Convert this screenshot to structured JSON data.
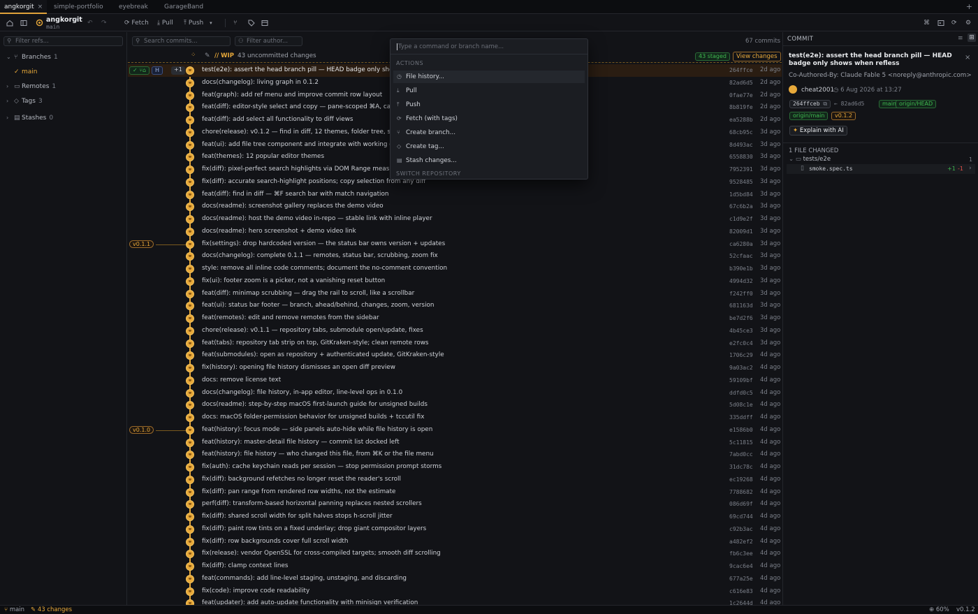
{
  "tabs": [
    {
      "label": "angkorgit",
      "active": true
    },
    {
      "label": "simple-portfolio"
    },
    {
      "label": "eyebreak"
    },
    {
      "label": "GarageBand"
    }
  ],
  "toolbar": {
    "repo_name": "angkorgit",
    "repo_branch": "main",
    "fetch": "Fetch",
    "pull": "Pull",
    "push": "Push"
  },
  "sidebar": {
    "filter_placeholder": "Filter refs...",
    "branches": {
      "label": "Branches",
      "count": "1"
    },
    "branch_main": "main",
    "remotes": {
      "label": "Remotes",
      "count": "1"
    },
    "tags": {
      "label": "Tags",
      "count": "3"
    },
    "stashes": {
      "label": "Stashes",
      "count": "0"
    }
  },
  "graph": {
    "search_placeholder": "Search commits...",
    "author_placeholder": "Filter author...",
    "commit_count": "67 commits",
    "wip_label": "WIP",
    "wip_text": "43 uncommitted changes",
    "staged": "43 staged",
    "view_changes": "View changes",
    "head_badge": "H",
    "plus_badge": "+1"
  },
  "commits": [
    {
      "msg": "test(e2e): assert the head branch pill — HEAD badge only shows wh",
      "sha": "264ffce",
      "ago": "2d ago"
    },
    {
      "msg": "docs(changelog): living graph in 0.1.2",
      "sha": "82ad6d5",
      "ago": "2d ago"
    },
    {
      "msg": "feat(graph): add ref menu and improve commit row layout",
      "sha": "0fae77e",
      "ago": "2d ago"
    },
    {
      "msg": "feat(diff): editor-style select and copy — pane-scoped ⌘A, caret, I-b",
      "sha": "8b819fe",
      "ago": "2d ago"
    },
    {
      "msg": "feat(diff): add select all functionality to diff views",
      "sha": "ea5288b",
      "ago": "2d ago"
    },
    {
      "msg": "chore(release): v0.1.2 — find in diff, 12 themes, folder tree, stash pre",
      "sha": "68cb95c",
      "ago": "3d ago"
    },
    {
      "msg": "feat(ui): add file tree component and integrate with working copy pa",
      "sha": "8d493ac",
      "ago": "3d ago"
    },
    {
      "msg": "feat(themes): 12 popular editor themes",
      "sha": "6558830",
      "ago": "3d ago"
    },
    {
      "msg": "fix(diff): pixel-perfect search highlights via DOM Range measuremen",
      "sha": "7952391",
      "ago": "3d ago"
    },
    {
      "msg": "fix(diff): accurate search-highlight positions; copy selection from any diff",
      "sha": "9528485",
      "ago": "3d ago"
    },
    {
      "msg": "feat(diff): find in diff — ⌘F search bar with match navigation",
      "sha": "1d5bd84",
      "ago": "3d ago"
    },
    {
      "msg": "docs(readme): screenshot gallery replaces the demo video",
      "sha": "67c6b2a",
      "ago": "3d ago"
    },
    {
      "msg": "docs(readme): host the demo video in-repo — stable link with inline player",
      "sha": "c1d9e2f",
      "ago": "3d ago"
    },
    {
      "msg": "docs(readme): hero screenshot + demo video link",
      "sha": "82009d1",
      "ago": "3d ago"
    },
    {
      "msg": "fix(settings): drop hardcoded version — the status bar owns version + updates",
      "sha": "ca6280a",
      "ago": "3d ago",
      "tag": "v0.1.1"
    },
    {
      "msg": "docs(changelog): complete 0.1.1 — remotes, status bar, scrubbing, zoom fix",
      "sha": "52cfaac",
      "ago": "3d ago"
    },
    {
      "msg": "style: remove all inline code comments; document the no-comment convention",
      "sha": "b390e1b",
      "ago": "3d ago"
    },
    {
      "msg": "fix(ui): footer zoom is a picker, not a vanishing reset button",
      "sha": "4994d32",
      "ago": "3d ago"
    },
    {
      "msg": "feat(diff): minimap scrubbing — drag the rail to scroll, like a scrollbar",
      "sha": "f242ff0",
      "ago": "3d ago"
    },
    {
      "msg": "feat(ui): status bar footer — branch, ahead/behind, changes, zoom, version",
      "sha": "681163d",
      "ago": "3d ago"
    },
    {
      "msg": "feat(remotes): edit and remove remotes from the sidebar",
      "sha": "be7d2f6",
      "ago": "3d ago"
    },
    {
      "msg": "chore(release): v0.1.1 — repository tabs, submodule open/update, fixes",
      "sha": "4b45ce3",
      "ago": "3d ago"
    },
    {
      "msg": "feat(tabs): repository tab strip on top, GitKraken-style; clean remote rows",
      "sha": "e2fc0c4",
      "ago": "3d ago"
    },
    {
      "msg": "feat(submodules): open as repository + authenticated update, GitKraken-style",
      "sha": "1706c29",
      "ago": "4d ago"
    },
    {
      "msg": "fix(history): opening file history dismisses an open diff preview",
      "sha": "9a03ac2",
      "ago": "4d ago"
    },
    {
      "msg": "docs: remove license text",
      "sha": "59109bf",
      "ago": "4d ago"
    },
    {
      "msg": "docs(changelog): file history, in-app editor, line-level ops in 0.1.0",
      "sha": "ddfd0c5",
      "ago": "4d ago"
    },
    {
      "msg": "docs(readme): step-by-step macOS first-launch guide for unsigned builds",
      "sha": "5d08c1e",
      "ago": "4d ago"
    },
    {
      "msg": "docs: macOS folder-permission behavior for unsigned builds + tccutil fix",
      "sha": "335ddff",
      "ago": "4d ago"
    },
    {
      "msg": "feat(history): focus mode — side panels auto-hide while file history is open",
      "sha": "e1586b0",
      "ago": "4d ago",
      "tag": "v0.1.0"
    },
    {
      "msg": "feat(history): master-detail file history — commit list docked left",
      "sha": "5c11815",
      "ago": "4d ago"
    },
    {
      "msg": "feat(history): file history — who changed this file, from ⌘K or the file menu",
      "sha": "7abd0cc",
      "ago": "4d ago"
    },
    {
      "msg": "fix(auth): cache keychain reads per session — stop permission prompt storms",
      "sha": "31dc78c",
      "ago": "4d ago"
    },
    {
      "msg": "fix(diff): background refetches no longer reset the reader's scroll",
      "sha": "ec19268",
      "ago": "4d ago"
    },
    {
      "msg": "fix(diff): pan range from rendered row widths, not the estimate",
      "sha": "7788682",
      "ago": "4d ago"
    },
    {
      "msg": "perf(diff): transform-based horizontal panning replaces nested scrollers",
      "sha": "086d69f",
      "ago": "4d ago"
    },
    {
      "msg": "fix(diff): shared scroll width for split halves stops h-scroll jitter",
      "sha": "69cd744",
      "ago": "4d ago"
    },
    {
      "msg": "fix(diff): paint row tints on a fixed underlay; drop giant compositor layers",
      "sha": "c92b3ac",
      "ago": "4d ago"
    },
    {
      "msg": "fix(diff): row backgrounds cover full scroll width",
      "sha": "a482ef2",
      "ago": "4d ago"
    },
    {
      "msg": "fix(release): vendor OpenSSL for cross-compiled targets; smooth diff scrolling",
      "sha": "fb6c3ee",
      "ago": "4d ago"
    },
    {
      "msg": "fix(diff): clamp context lines",
      "sha": "9cac6e4",
      "ago": "4d ago"
    },
    {
      "msg": "feat(commands): add line-level staging, unstaging, and discarding",
      "sha": "677a25e",
      "ago": "4d ago"
    },
    {
      "msg": "fix(code): improve code readability",
      "sha": "c616e83",
      "ago": "4d ago"
    },
    {
      "msg": "feat(updater): add auto-update functionality with minisign verification",
      "sha": "1c2644d",
      "ago": "4d ago"
    }
  ],
  "palette": {
    "placeholder": "Type a command or branch name...",
    "actions_header": "ACTIONS",
    "items": [
      "File history...",
      "Pull",
      "Push",
      "Fetch (with tags)",
      "Create branch...",
      "Create tag...",
      "Stash changes..."
    ],
    "switch_header": "SWITCH REPOSITORY"
  },
  "detail": {
    "header": "COMMIT",
    "title": "test(e2e): assert the head branch pill — HEAD badge only shows when refless",
    "coauthor": "Co-Authored-By: Claude Fable 5 <noreply@anthropic.com>",
    "author": "cheat2001",
    "date": "6 Aug 2026 at 13:27",
    "sha": "264ffceb",
    "parent": "82ad6d5",
    "refs": [
      "main",
      "origin/HEAD",
      "origin/main",
      "v0.1.2"
    ],
    "explain": "Explain with AI",
    "files_header": "1 FILE CHANGED",
    "files_count": "1",
    "folder": "tests/e2e",
    "file": "smoke.spec.ts",
    "additions": "+1",
    "deletions": "-1"
  },
  "status": {
    "branch": "main",
    "changes": "43 changes",
    "zoom": "60%",
    "version": "v0.1.2"
  },
  "colors": {
    "accent": "#e8a93a",
    "green": "#3fb950",
    "bg": "#121317"
  }
}
